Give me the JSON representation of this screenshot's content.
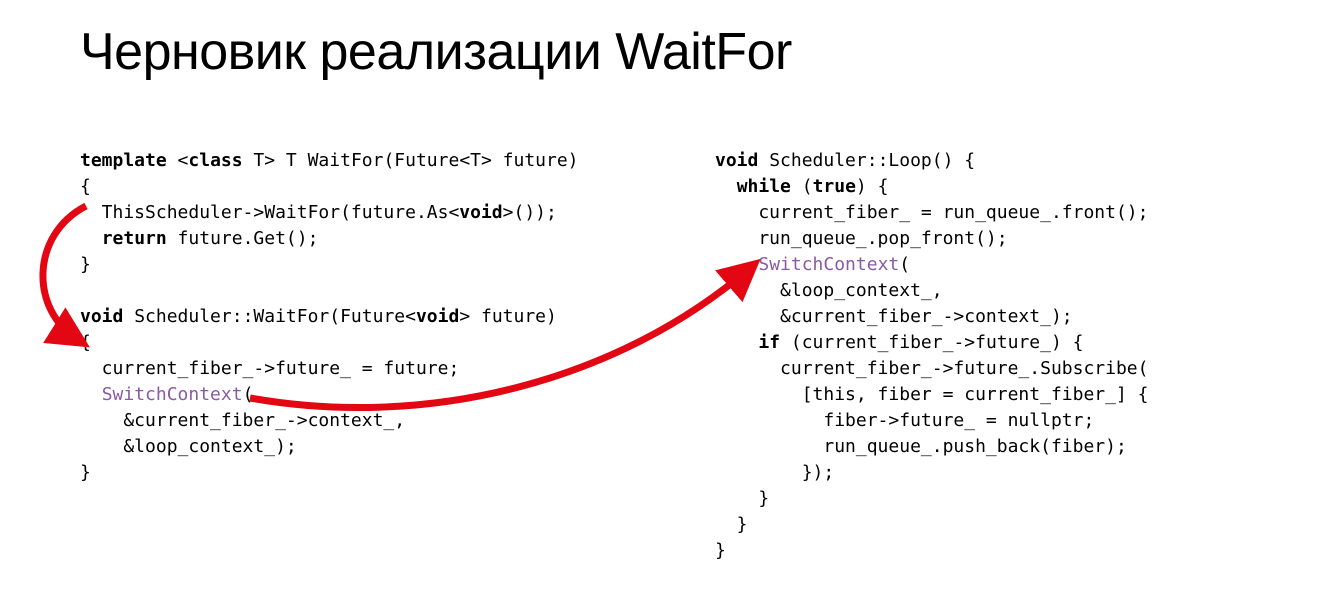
{
  "title": "Черновик реализации WaitFor",
  "left_code": {
    "l1a": "template",
    "l1b": " <",
    "l1c": "class",
    "l1d": " T> T WaitFor(Future<T> future)",
    "l2": "{",
    "l3a": "  ThisScheduler->WaitFor(future.As<",
    "l3b": "void",
    "l3c": ">());",
    "l4a": "  ",
    "l4b": "return",
    "l4c": " future.Get();",
    "l5": "}",
    "l6": "",
    "l7a": "void",
    "l7b": " Scheduler::WaitFor(Future<",
    "l7c": "void",
    "l7d": "> future)",
    "l8": "{",
    "l9": "  current_fiber_->future_ = future;",
    "l10a": "  ",
    "l10b": "SwitchContext",
    "l10c": "(",
    "l11": "    &current_fiber_->context_,",
    "l12": "    &loop_context_);",
    "l13": "}"
  },
  "right_code": {
    "r1a": "void",
    "r1b": " Scheduler::Loop() {",
    "r2a": "  ",
    "r2b": "while",
    "r2c": " (",
    "r2d": "true",
    "r2e": ") {",
    "r3": "    current_fiber_ = run_queue_.front();",
    "r4": "    run_queue_.pop_front();",
    "r5a": "    ",
    "r5b": "SwitchContext",
    "r5c": "(",
    "r6": "      &loop_context_,",
    "r7": "      &current_fiber_->context_);",
    "r8a": "    ",
    "r8b": "if",
    "r8c": " (current_fiber_->future_) {",
    "r9": "      current_fiber_->future_.Subscribe(",
    "r10": "        [this, fiber = current_fiber_] {",
    "r11": "          fiber->future_ = nullptr;",
    "r12": "          run_queue_.push_back(fiber);",
    "r13": "        });",
    "r14": "    }",
    "r15": "  }",
    "r16": "}"
  },
  "colors": {
    "arrow": "#e30613",
    "keyword": "#000000",
    "call": "#8a5aa5"
  }
}
